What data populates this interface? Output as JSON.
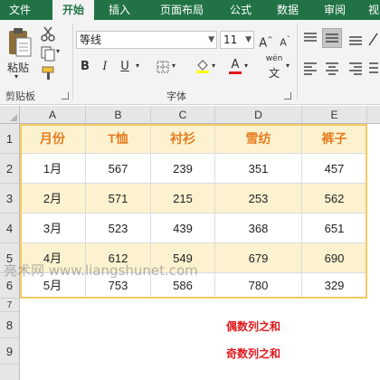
{
  "ribbon": {
    "tabs": [
      "文件",
      "开始",
      "插入",
      "页面布局",
      "公式",
      "数据",
      "审阅",
      "视"
    ],
    "active_tab": "开始",
    "clipboard": {
      "paste_label": "粘贴",
      "group_label": "剪贴板"
    },
    "font": {
      "name": "等线",
      "size": "11",
      "bold": "B",
      "italic": "I",
      "underline": "U",
      "grow": "A",
      "shrink": "A",
      "font_color_glyph": "A",
      "phonetic": "wén",
      "group_label": "字体"
    }
  },
  "sheet": {
    "columns": [
      "A",
      "B",
      "C",
      "D",
      "E"
    ],
    "rows": [
      "1",
      "2",
      "3",
      "4",
      "5",
      "6",
      "7",
      "8",
      "9"
    ],
    "headers": [
      "月份",
      "T恤",
      "衬衫",
      "雪纺",
      "裤子"
    ],
    "data": [
      [
        "1月",
        "567",
        "239",
        "351",
        "457"
      ],
      [
        "2月",
        "571",
        "215",
        "253",
        "562"
      ],
      [
        "3月",
        "523",
        "439",
        "368",
        "651"
      ],
      [
        "4月",
        "612",
        "549",
        "679",
        "690"
      ],
      [
        "5月",
        "753",
        "586",
        "780",
        "329"
      ]
    ],
    "label_even": "偶数列之和",
    "label_odd": "奇数列之和",
    "watermark": "亮术网 www.liangshunet.com"
  },
  "colors": {
    "ribbon_green": "#217346",
    "header_text": "#e67e22",
    "band_fill": "#fdf2d0",
    "table_border": "#f5c862",
    "label_red": "#e0191b"
  }
}
